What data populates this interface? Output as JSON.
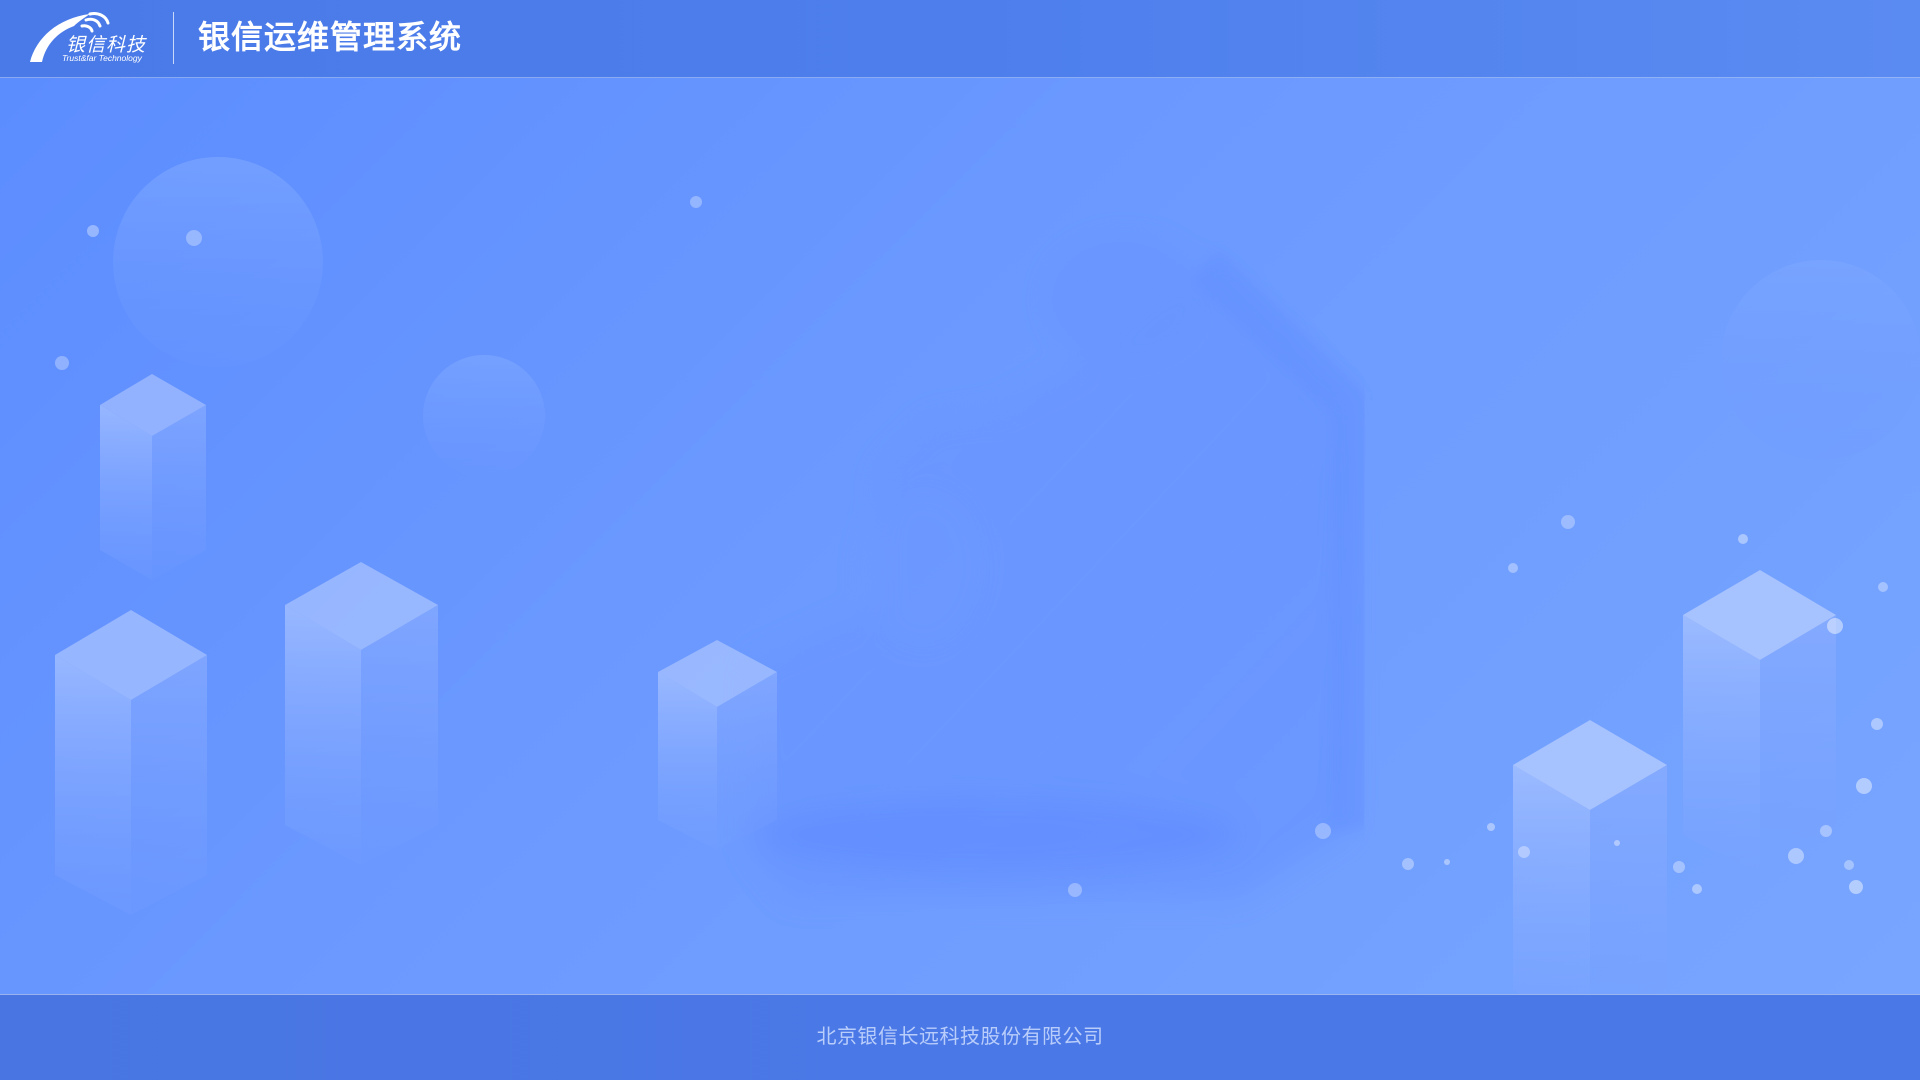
{
  "header": {
    "logo_cn": "银信科技",
    "logo_en": "Trust&far Technology",
    "system_title": "银信运维管理系统"
  },
  "footer": {
    "company": "北京银信长远科技股份有限公司"
  },
  "colors": {
    "header_bg": "#4d7eec",
    "page_bg": "#6a98ff",
    "footer_bg": "#4a78e6",
    "footer_text": "#b9cdfb",
    "title_text": "#ffffff"
  },
  "icons": {
    "logo": "trustfar-arc-logo"
  }
}
